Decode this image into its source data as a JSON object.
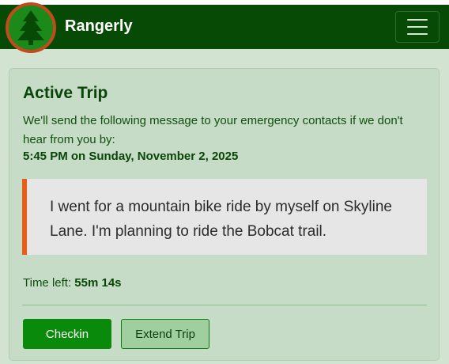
{
  "nav": {
    "brand": "Rangerly",
    "logo_icon": "pine-tree-icon",
    "menu_icon": "hamburger-menu-icon"
  },
  "trip": {
    "title": "Active Trip",
    "intro": "We'll send the following message to your emergency contacts if we don't hear from you by:",
    "deadline": "5:45 PM on Sunday, November 2, 2025",
    "message": "I went for a mountain bike ride by myself on Skyline Lane. I'm planning to ride the Bobcat trail.",
    "time_left_label": "Time left:",
    "time_left_value": "55m 14s"
  },
  "actions": {
    "checkin_label": "Checkin",
    "extend_label": "Extend Trip"
  },
  "colors": {
    "navbar": "#064a06",
    "page_bg": "#d3e3d2",
    "card_bg": "#c6dcc6",
    "accent_border": "#e85d17",
    "primary_button": "#0a8a0a",
    "secondary_button": "#9fcf9f"
  }
}
